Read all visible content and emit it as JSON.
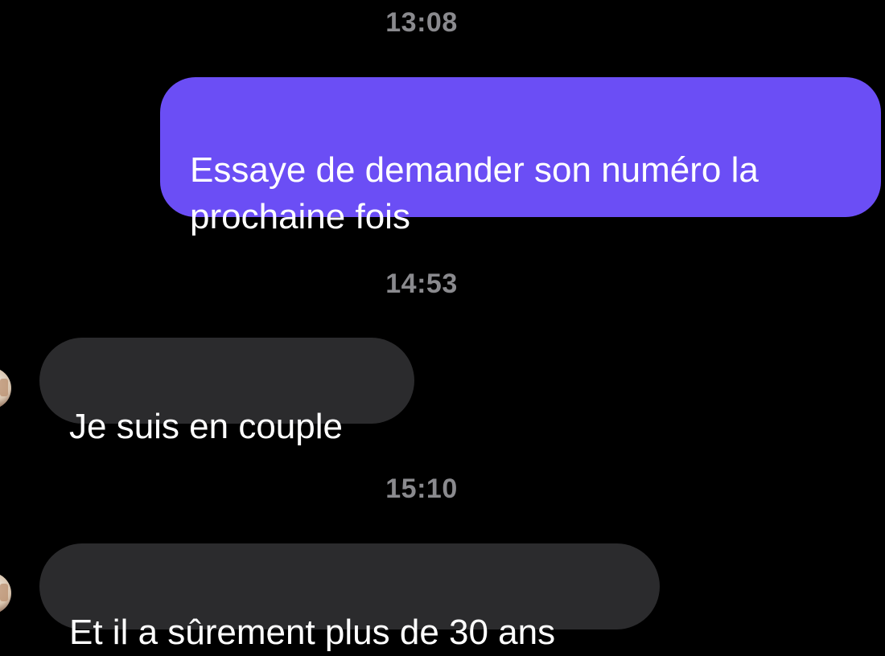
{
  "conversation": {
    "messages": [
      {
        "timestamp": "13:08",
        "direction": "outgoing",
        "text": "Essaye de demander son numéro la\nprochaine fois"
      },
      {
        "timestamp": "14:53",
        "direction": "incoming",
        "text": "Je suis en couple"
      },
      {
        "timestamp": "15:10",
        "direction": "incoming",
        "text": "Et il a sûrement plus de 30 ans"
      }
    ]
  },
  "colors": {
    "background": "#000000",
    "outgoing_bubble": "#6b4ef5",
    "incoming_bubble": "#2b2b2d",
    "timestamp_text": "#8a8a8e",
    "message_text": "#ffffff"
  },
  "icons": {
    "contact_avatar": "avatar"
  }
}
